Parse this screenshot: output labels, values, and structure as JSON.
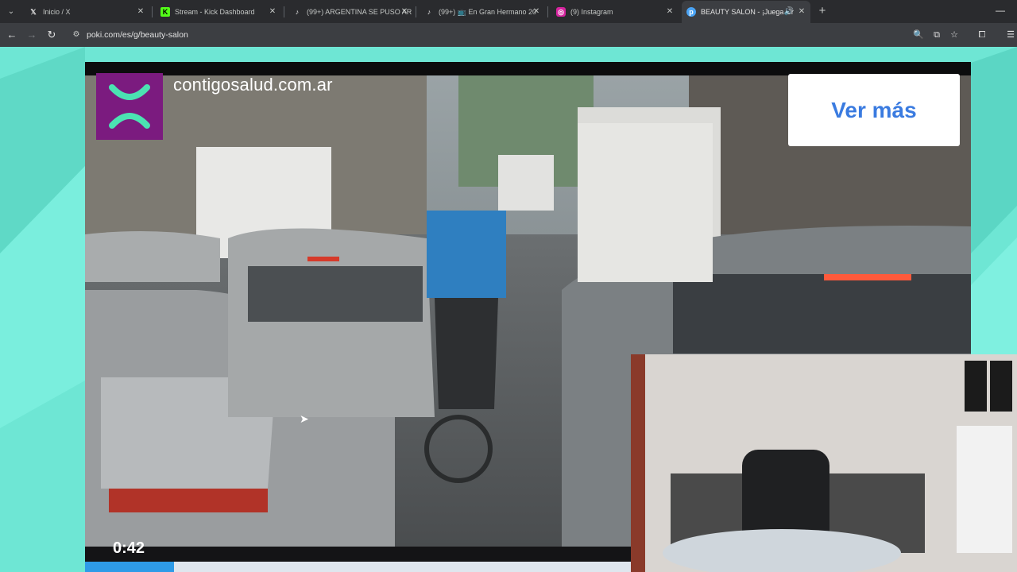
{
  "browser": {
    "tabs": [
      {
        "title": "Inicio / X",
        "icon": "x-logo-icon",
        "active": false
      },
      {
        "title": "Stream - Kick Dashboard",
        "icon": "kick-logo-icon",
        "active": false
      },
      {
        "title": "(99+) ARGENTINA SE PUSO AR",
        "icon": "tiktok-logo-icon",
        "active": false
      },
      {
        "title": "(99+) 📺 En Gran Hermano 20",
        "icon": "tiktok-logo-icon",
        "active": false
      },
      {
        "title": "(9) Instagram",
        "icon": "instagram-logo-icon",
        "active": false
      },
      {
        "title": "BEAUTY SALON - ¡Juega Gr",
        "icon": "poki-logo-icon",
        "active": true
      }
    ],
    "url": "poki.com/es/g/beauty-salon",
    "colors": {
      "tabstrip": "#2a2b2e",
      "toolbar": "#3c3e42",
      "page_bg": "#6ee6d4"
    }
  },
  "ad": {
    "brand": "contigosalud.com.ar",
    "cta": "Ver más",
    "time": "0:42",
    "progress": 0.1,
    "colors": {
      "brand_logo": "#7b1b7f",
      "cta_text": "#3a7be0",
      "progress": "#2e9be8"
    }
  }
}
